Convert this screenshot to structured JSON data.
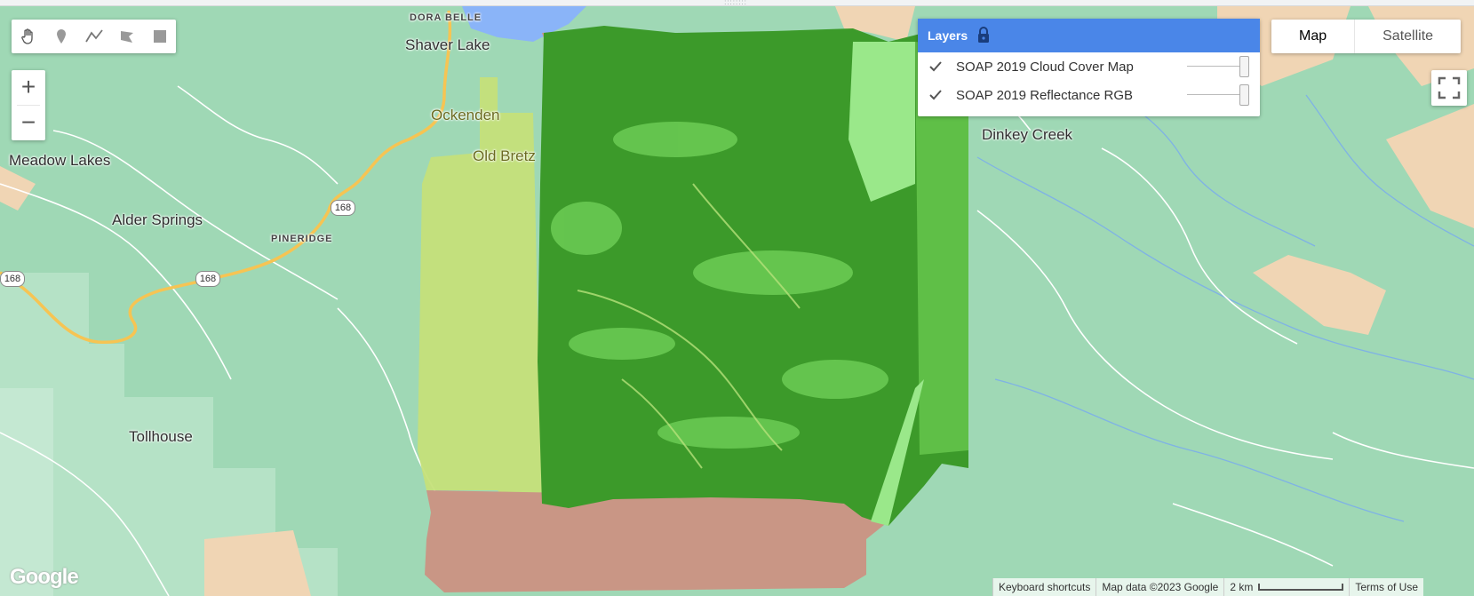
{
  "toolbar": {
    "tools": [
      {
        "name": "hand-icon"
      },
      {
        "name": "marker-icon"
      },
      {
        "name": "polyline-icon"
      },
      {
        "name": "polygon-icon"
      },
      {
        "name": "rectangle-icon"
      }
    ],
    "zoom_in": "+",
    "zoom_out": "−"
  },
  "layers_panel": {
    "title": "Layers",
    "items": [
      {
        "label": "SOAP 2019 Cloud Cover Map",
        "checked": true,
        "opacity": 1.0
      },
      {
        "label": "SOAP 2019 Reflectance RGB",
        "checked": true,
        "opacity": 1.0
      }
    ]
  },
  "map_type": {
    "options": [
      "Map",
      "Satellite"
    ],
    "selected": "Map"
  },
  "places": {
    "dora_belle": "DORA BELLE",
    "shaver_lake": "Shaver Lake",
    "ockenden": "Ockenden",
    "old_bretz": "Old Bretz",
    "meadow_lakes": "Meadow Lakes",
    "alder_springs": "Alder Springs",
    "pineridge": "PINERIDGE",
    "tollhouse": "Tollhouse",
    "dinkey_creek": "Dinkey Creek"
  },
  "route_shields": [
    "168",
    "168",
    "168"
  ],
  "footer": {
    "logo": "Google",
    "keyboard_shortcuts": "Keyboard shortcuts",
    "map_data": "Map data ©2023 Google",
    "scale": "2 km",
    "terms": "Terms of Use"
  },
  "colors": {
    "layers_header": "#4a86e8",
    "map_green": "#9fd8b5",
    "reflectance_green": "#3c9a2a",
    "cloud_yellow": "#c5e07a",
    "cloud_brown": "#c99685",
    "highway": "#f6c453"
  }
}
